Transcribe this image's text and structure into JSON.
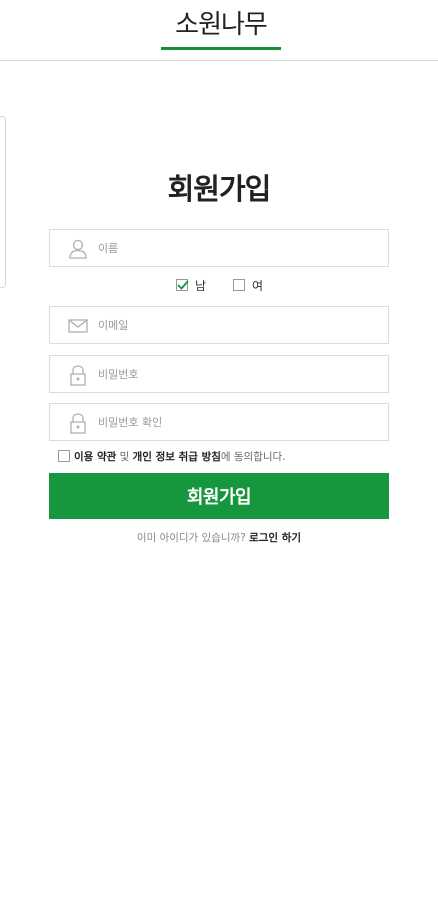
{
  "header": {
    "logo_text": "소원나무",
    "brand_color": "#1a8f3a"
  },
  "page_title": "회원가입",
  "form": {
    "name_placeholder": "이름",
    "gender": {
      "male_label": "남",
      "male_checked": true,
      "female_label": "여",
      "female_checked": false
    },
    "email_placeholder": "이메일",
    "password_placeholder": "비밀번호",
    "password_confirm_placeholder": "비밀번호 확인",
    "agreement": {
      "terms_link": "이용 약관",
      "and_text": " 및 ",
      "privacy_link": "개인 정보 취급 방침",
      "suffix_text": "에 동의합니다.",
      "checked": false
    },
    "submit_label": "회원가입",
    "submit_color": "#16963d"
  },
  "login_prompt": {
    "text": "이미 아이디가 있습니까? ",
    "link_label": "로그인 하기"
  },
  "icons": {
    "name": "user-icon",
    "email": "envelope-icon",
    "password": "lock-icon",
    "password_confirm": "lock-icon"
  }
}
